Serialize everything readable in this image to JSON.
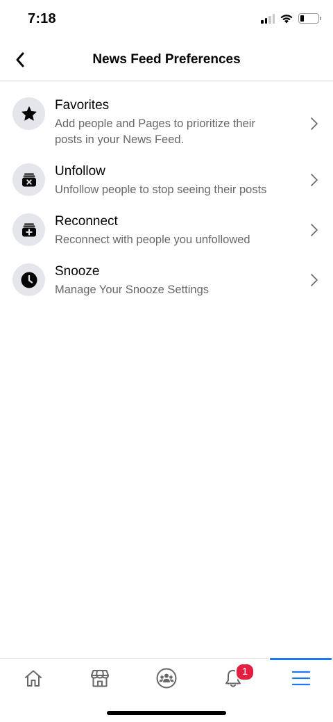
{
  "status_bar": {
    "time": "7:18",
    "signal_icon": "cellular-signal-icon",
    "wifi_icon": "wifi-icon",
    "battery_icon": "battery-icon",
    "battery_level": 0.2
  },
  "header": {
    "title": "News Feed Preferences",
    "back_icon": "chevron-left-icon"
  },
  "preferences": [
    {
      "title": "Favorites",
      "description": "Add people and Pages to prioritize their posts in your News Feed.",
      "icon": "star-icon"
    },
    {
      "title": "Unfollow",
      "description": "Unfollow people to stop seeing their posts",
      "icon": "unfollow-inbox-icon"
    },
    {
      "title": "Reconnect",
      "description": "Reconnect with people you unfollowed",
      "icon": "reconnect-inbox-icon"
    },
    {
      "title": "Snooze",
      "description": "Manage Your Snooze Settings",
      "icon": "clock-icon"
    }
  ],
  "tab_bar": {
    "tabs": [
      {
        "name": "home",
        "icon": "home-icon"
      },
      {
        "name": "marketplace",
        "icon": "marketplace-icon"
      },
      {
        "name": "groups",
        "icon": "groups-icon"
      },
      {
        "name": "notifications",
        "icon": "bell-icon",
        "badge": "1"
      },
      {
        "name": "menu",
        "icon": "hamburger-menu-icon",
        "active": true
      }
    ]
  },
  "colors": {
    "accent": "#1877f2",
    "badge": "#e41e3f",
    "icon_circle": "#e4e6eb",
    "secondary_text": "#65676b"
  }
}
